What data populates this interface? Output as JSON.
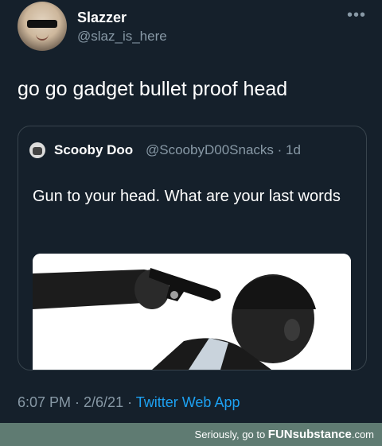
{
  "tweet": {
    "name": "Slazzer",
    "handle": "@slaz_is_here",
    "more_icon": "more-horizontal-icon",
    "text": "go go gadget bullet proof head",
    "timestamp": "6:07 PM · 2/6/21 · ",
    "source": "Twitter Web App"
  },
  "quote": {
    "name": "Scooby Doo",
    "handle_time": "@ScoobyD00Snacks · 1d",
    "text": "Gun to your head. What are your last words"
  },
  "footer": {
    "prefix": "Seriously, go to ",
    "brand": "FUNsubstance",
    "suffix": ".com"
  },
  "colors": {
    "background": "#15202b",
    "secondary_text": "#8899a6",
    "link": "#1da1f2",
    "border": "#38444d",
    "footer_bg": "#5f7b72"
  }
}
